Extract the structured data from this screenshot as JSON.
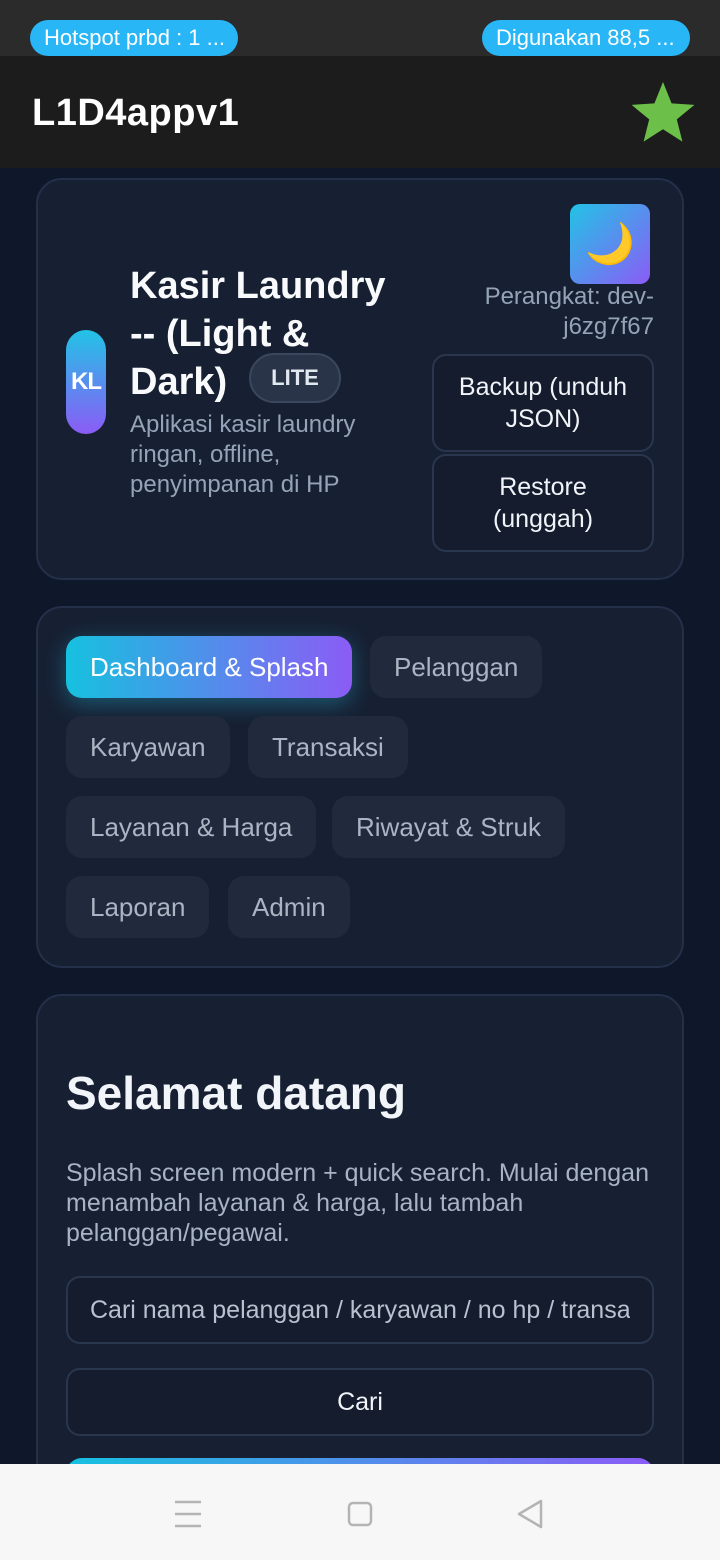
{
  "status_bar": {
    "hotspot": "Hotspot prbd : 1 ...",
    "usage": "Digunakan 88,5 ..."
  },
  "app_bar": {
    "title": "L1D4appv1",
    "action_icon": "star-icon",
    "action_color": "#6cc04a"
  },
  "header": {
    "logo_text": "KL",
    "app_name": "Kasir Laundry -- (Light & Dark)",
    "badge": "LITE",
    "description": "Aplikasi kasir laundry ringan, offline, penyimpanan di HP",
    "theme_toggle_icon": "moon-icon",
    "device_label": "Perangkat: dev-j6zg7f67",
    "backup_label": "Backup (unduh JSON)",
    "restore_label": "Restore (unggah)"
  },
  "tabs": [
    {
      "label": "Dashboard & Splash",
      "active": true
    },
    {
      "label": "Pelanggan",
      "active": false
    },
    {
      "label": "Karyawan",
      "active": false
    },
    {
      "label": "Transaksi",
      "active": false
    },
    {
      "label": "Layanan & Harga",
      "active": false
    },
    {
      "label": "Riwayat & Struk",
      "active": false
    },
    {
      "label": "Laporan",
      "active": false
    },
    {
      "label": "Admin",
      "active": false
    }
  ],
  "welcome": {
    "title": "Selamat datang",
    "description": "Splash screen modern + quick search. Mulai dengan menambah layanan & harga, lalu tambah pelanggan/pegawai.",
    "search_placeholder": "Cari nama pelanggan / karyawan / no hp / transaksi",
    "search_button": "Cari"
  },
  "nav_bar": {
    "icons": [
      "menu-icon",
      "home-square-icon",
      "back-triangle-icon"
    ]
  },
  "colors": {
    "background": "#0f172a",
    "card": "#172033",
    "accent_start": "#16c1df",
    "accent_end": "#8b5cf6",
    "status_pill": "#29b6f6"
  }
}
